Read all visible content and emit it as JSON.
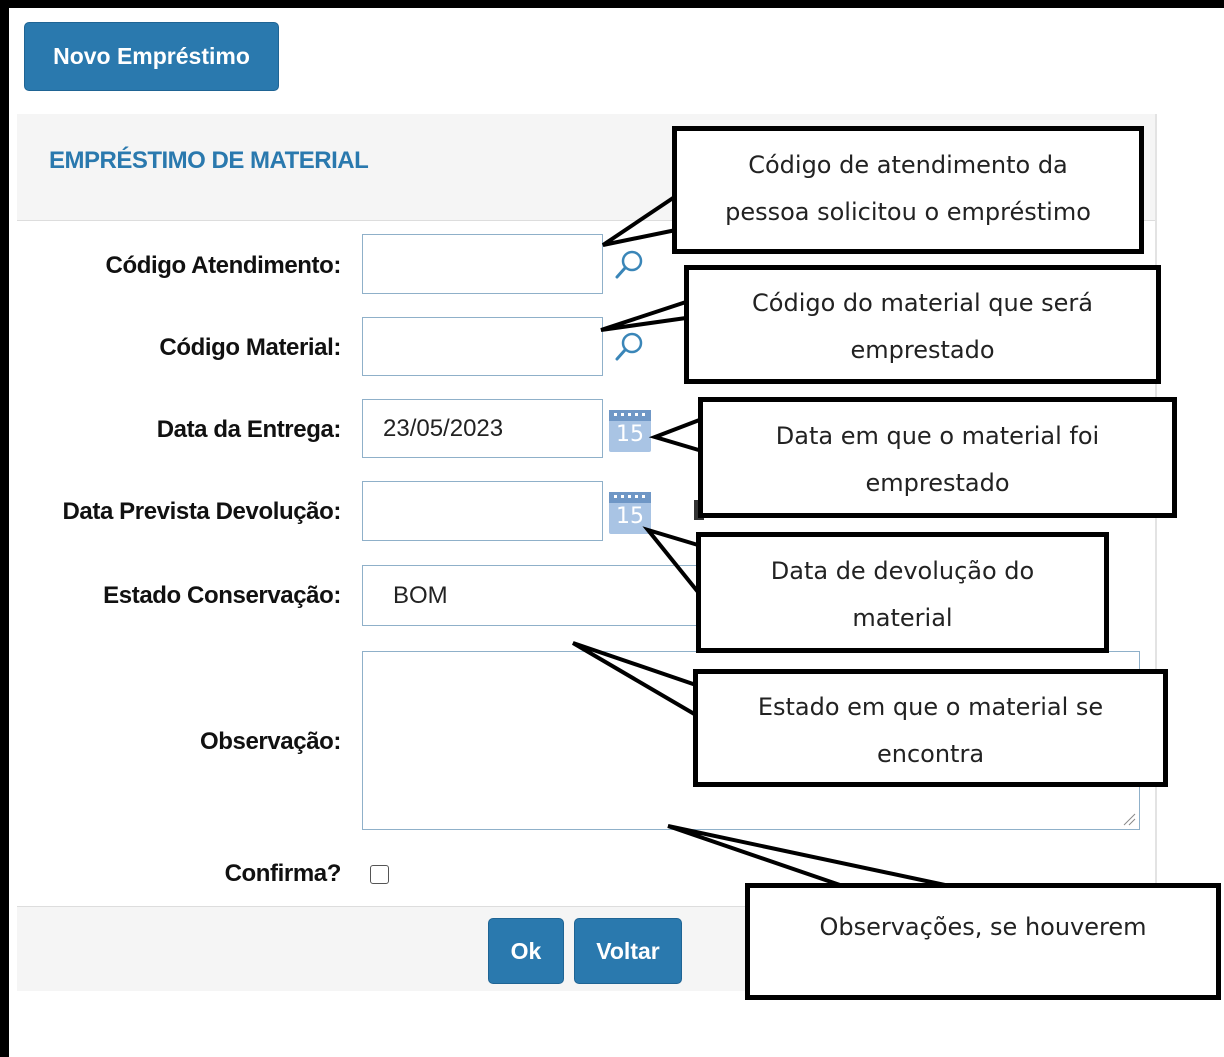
{
  "top_button": {
    "label": "Novo Empréstimo"
  },
  "panel": {
    "title": "EMPRÉSTIMO DE MATERIAL"
  },
  "fields": {
    "codigo_atendimento": {
      "label": "Código Atendimento:",
      "value": ""
    },
    "codigo_material": {
      "label": "Código Material:",
      "value": ""
    },
    "data_entrega": {
      "label": "Data da Entrega:",
      "value": "23/05/2023",
      "calendar_day": "15"
    },
    "data_prevista": {
      "label": "Data Prevista Devolução:",
      "value": "",
      "calendar_day": "15"
    },
    "estado_conservacao": {
      "label": "Estado Conservação:",
      "value": "BOM"
    },
    "observacao": {
      "label": "Observação:",
      "value": ""
    },
    "confirma": {
      "label": "Confirma?",
      "checked": false
    }
  },
  "footer": {
    "ok_label": "Ok",
    "voltar_label": "Voltar"
  },
  "callouts": {
    "atendimento": {
      "line1": "Código de atendimento da",
      "line2": "pessoa solicitou o empréstimo"
    },
    "material": {
      "line1": "Código do material que será",
      "line2": "emprestado"
    },
    "entrega": {
      "line1": "Data em que o material foi",
      "line2": "emprestado"
    },
    "devolucao": {
      "line1": "Data de devolução do",
      "line2": "material"
    },
    "estado": {
      "line1": "Estado em que o material se",
      "line2": "encontra"
    },
    "observacoes": {
      "line1": "Observações, se houverem"
    }
  },
  "colors": {
    "accent": "#2a79ae",
    "panel_bg": "#f5f5f5",
    "calendar": "#8fb3d9"
  },
  "icons": {
    "search": "search-icon",
    "calendar": "calendar-icon"
  }
}
